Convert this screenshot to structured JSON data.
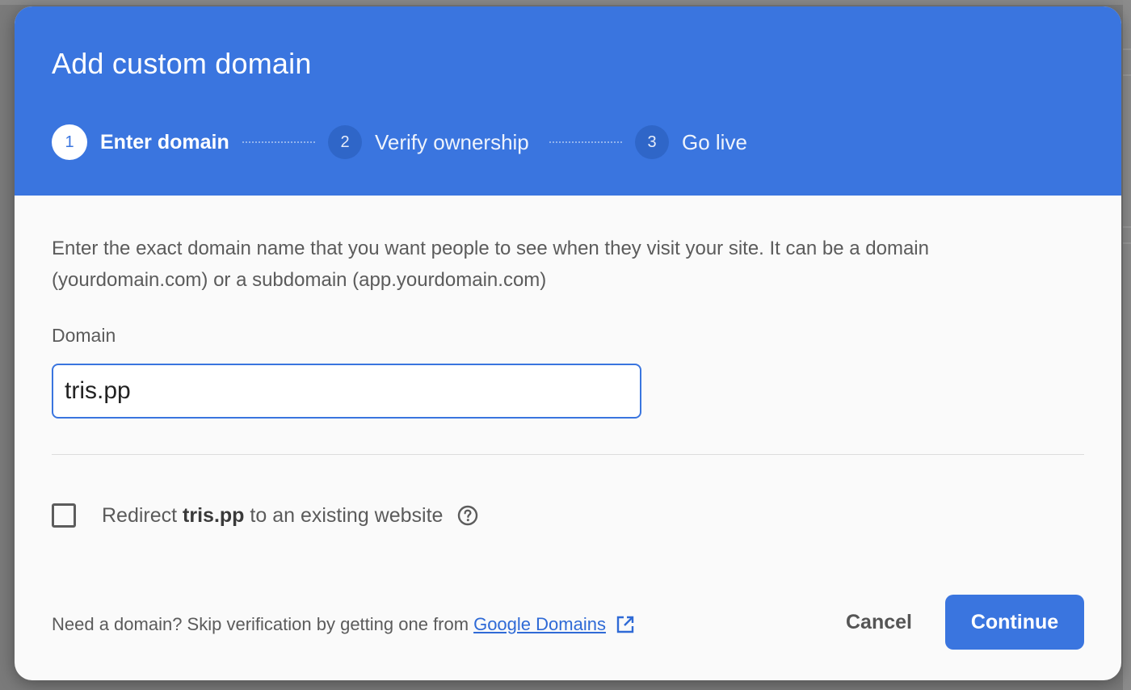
{
  "dialog": {
    "title": "Add custom domain",
    "steps": [
      {
        "number": "1",
        "label": "Enter domain"
      },
      {
        "number": "2",
        "label": "Verify ownership"
      },
      {
        "number": "3",
        "label": "Go live"
      }
    ],
    "description": "Enter the exact domain name that you want people to see when they visit your site. It can be a domain (yourdomain.com) or a subdomain (app.yourdomain.com)",
    "domain_field": {
      "label": "Domain",
      "value": "tris.pp"
    },
    "redirect": {
      "prefix": "Redirect",
      "domain": "tris.pp",
      "suffix": "to an existing website",
      "checked": false
    },
    "footer": {
      "note": "Need a domain? Skip verification by getting one from",
      "link_text": "Google Domains"
    },
    "buttons": {
      "cancel": "Cancel",
      "continue": "Continue"
    }
  },
  "colors": {
    "header_bg": "#3a75df",
    "primary": "#3a75df",
    "link": "#2f6ad6"
  },
  "icons": {
    "help": "help-circle-icon",
    "external": "open-in-new-icon"
  }
}
